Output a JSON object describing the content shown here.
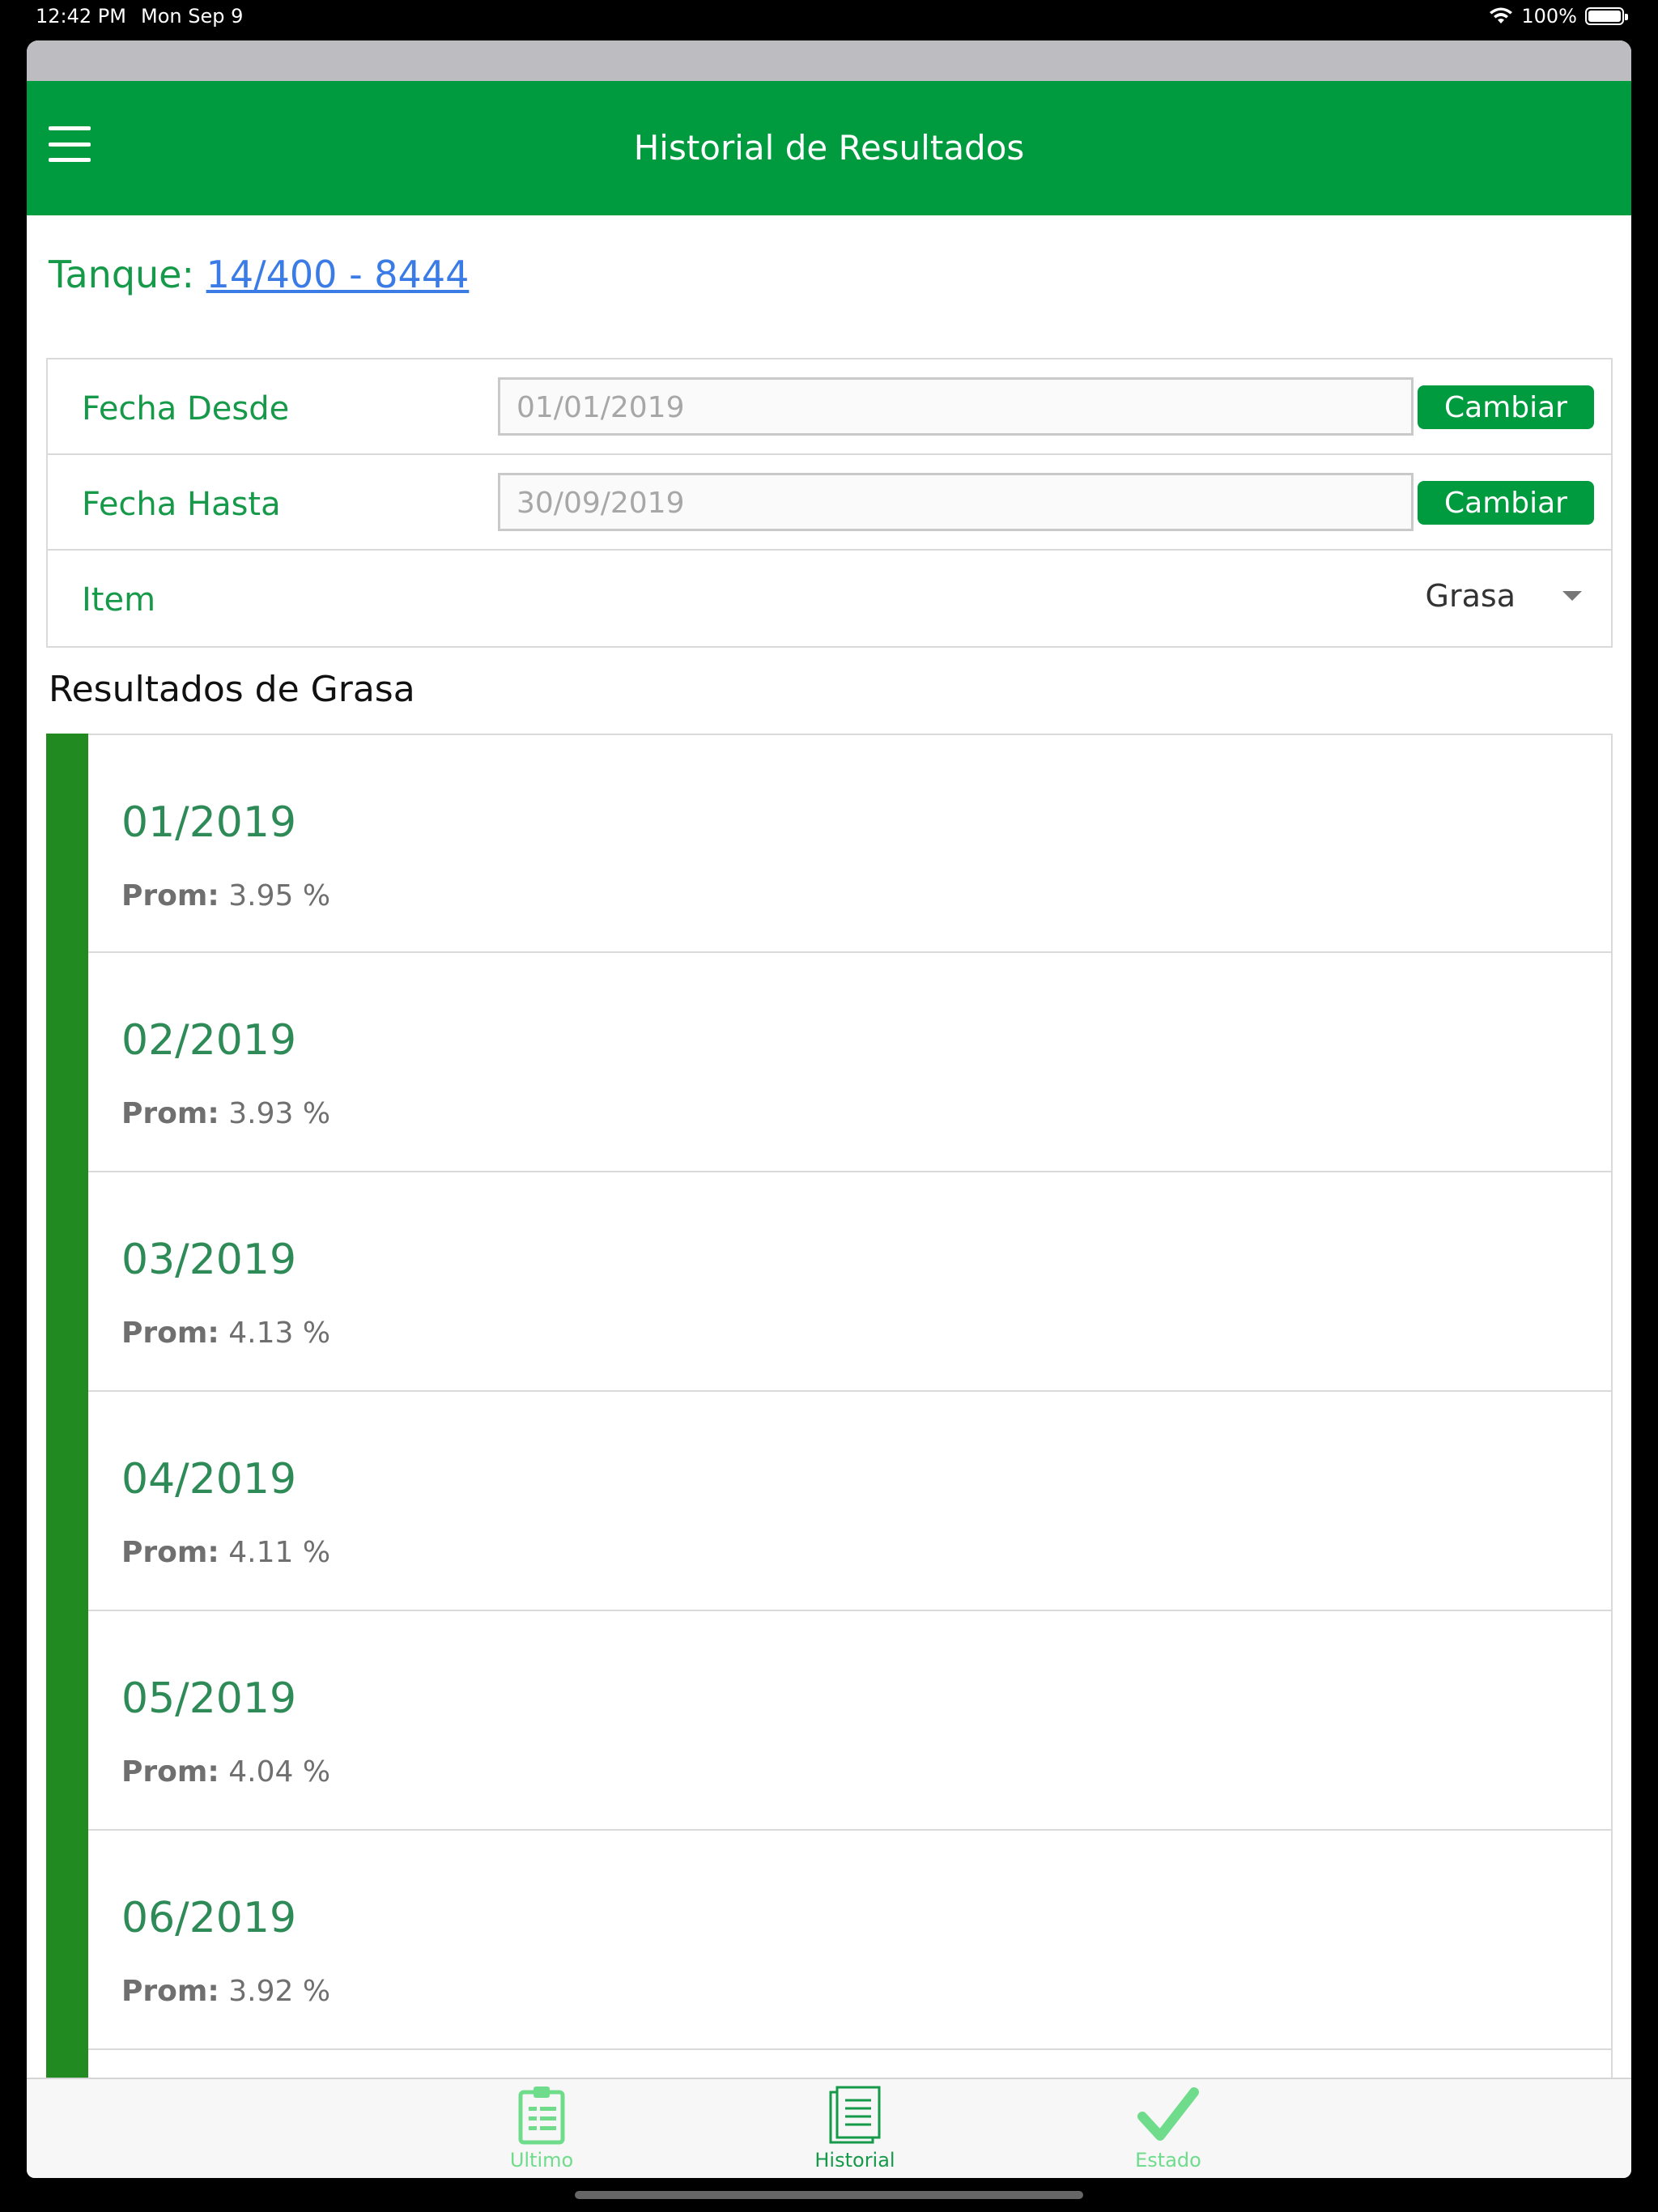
{
  "status_bar": {
    "time": "12:42 PM",
    "date": "Mon Sep 9",
    "battery": "100%"
  },
  "header": {
    "title": "Historial de Resultados"
  },
  "tanque": {
    "label": "Tanque:",
    "value": "14/400 - 8444"
  },
  "filters": {
    "fecha_desde": {
      "label": "Fecha Desde",
      "value": "01/01/2019",
      "button": "Cambiar"
    },
    "fecha_hasta": {
      "label": "Fecha Hasta",
      "value": "30/09/2019",
      "button": "Cambiar"
    },
    "item": {
      "label": "Item",
      "selected": "Grasa"
    }
  },
  "results": {
    "title": "Resultados de Grasa",
    "prom_label": "Prom:",
    "items": [
      {
        "date": "01/2019",
        "prom": "3.95 %"
      },
      {
        "date": "02/2019",
        "prom": "3.93 %"
      },
      {
        "date": "03/2019",
        "prom": "4.13 %"
      },
      {
        "date": "04/2019",
        "prom": "4.11 %"
      },
      {
        "date": "05/2019",
        "prom": "4.04 %"
      },
      {
        "date": "06/2019",
        "prom": "3.92 %"
      }
    ]
  },
  "tabs": [
    {
      "label": "Ultimo",
      "icon": "clipboard-icon"
    },
    {
      "label": "Historial",
      "icon": "document-list-icon"
    },
    {
      "label": "Estado",
      "icon": "checkmark-icon"
    }
  ],
  "colors": {
    "brand_green": "#009b3e",
    "label_green": "#169a4a",
    "link_blue": "#3b7be6",
    "bar_green": "#218b21"
  }
}
